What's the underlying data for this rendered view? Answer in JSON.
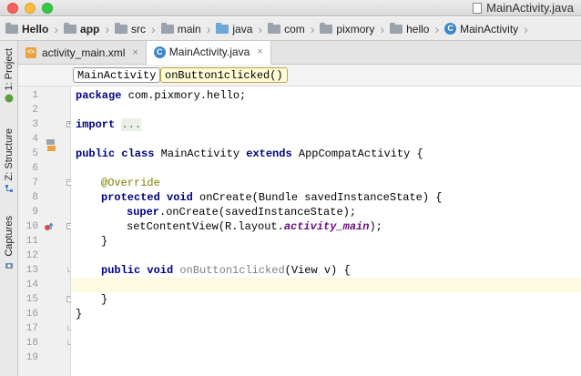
{
  "window": {
    "title": "MainActivity.java"
  },
  "breadcrumb": [
    {
      "label": "Hello",
      "icon": "folder-icon",
      "bold": true
    },
    {
      "label": "app",
      "icon": "folder-icon",
      "bold": true
    },
    {
      "label": "src",
      "icon": "folder-icon"
    },
    {
      "label": "main",
      "icon": "folder-icon"
    },
    {
      "label": "java",
      "icon": "folder-icon"
    },
    {
      "label": "com",
      "icon": "folder-icon"
    },
    {
      "label": "pixmory",
      "icon": "folder-icon"
    },
    {
      "label": "hello",
      "icon": "folder-icon"
    },
    {
      "label": "MainActivity",
      "icon": "class-icon"
    }
  ],
  "sidebar": {
    "project": "1: Project",
    "structure": "Z: Structure",
    "captures": "Captures"
  },
  "tabs": [
    {
      "label": "activity_main.xml",
      "close": "×",
      "active": false
    },
    {
      "label": "MainActivity.java",
      "close": "×",
      "active": true
    }
  ],
  "structure": {
    "class_name": "MainActivity",
    "method_name": "onButton1clicked()"
  },
  "editor": {
    "line_numbers": [
      "1",
      "2",
      "3",
      "4",
      "5",
      "6",
      "7",
      "8",
      "9",
      "10",
      "11",
      "12",
      "13",
      "14",
      "15",
      "16",
      "17",
      "18",
      "19"
    ],
    "current_line": 16,
    "lines": {
      "l1_kw": "package",
      "l1_rest": " com.pixmory.hello;",
      "l3_kw": "import",
      "l3_folded": "...",
      "l7_kw1": "public class",
      "l7_name": " MainActivity ",
      "l7_kw2": "extends",
      "l7_rest": " AppCompatActivity {",
      "l9_ann": "@Override",
      "l10_kw": "protected void",
      "l10_rest": " onCreate(Bundle savedInstanceState) {",
      "l11_kw": "super",
      "l11_rest": ".onCreate(savedInstanceState);",
      "l12_a": "setContentView(R.layout.",
      "l12_field": "activity_main",
      "l12_b": ");",
      "l13": "}",
      "l15_kw": "public void",
      "l15_name": " onButton1clicked",
      "l15_rest": "(View v) {",
      "l17": "}",
      "l18": "}"
    }
  }
}
